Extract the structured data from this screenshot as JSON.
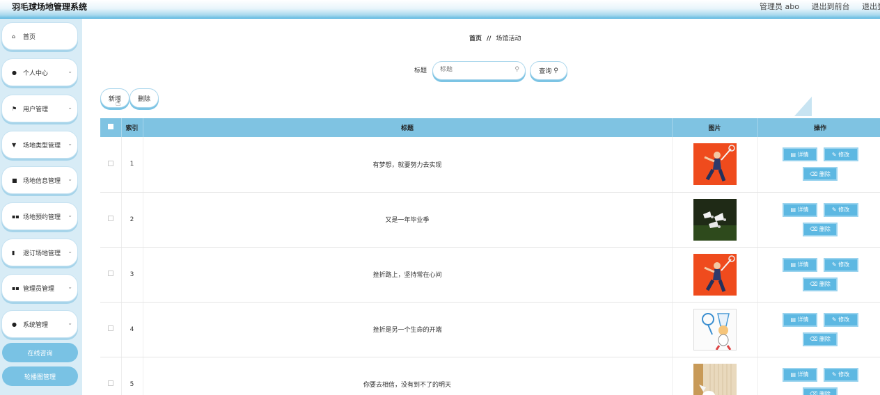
{
  "header": {
    "title": "羽毛球场地管理系统",
    "user": "管理员 abo",
    "to_front": "退出到前台",
    "logout": "退出登录"
  },
  "sidebar": {
    "items": [
      {
        "label": "首页",
        "icon": "home-icon",
        "glyph": "⌂",
        "arrow": ""
      },
      {
        "label": "个人中心",
        "icon": "user-icon",
        "glyph": "●",
        "arrow": "⌄"
      },
      {
        "label": "用户管理",
        "icon": "flag-icon",
        "glyph": "⚑",
        "arrow": "⌄"
      },
      {
        "label": "场地类型管理",
        "icon": "tag-icon",
        "glyph": "▼",
        "arrow": "⌄"
      },
      {
        "label": "场地信息管理",
        "icon": "checkbox-icon",
        "glyph": "■",
        "arrow": "⌄"
      },
      {
        "label": "场地预约管理",
        "icon": "grid-icon",
        "glyph": "▪▪",
        "arrow": "⌄"
      },
      {
        "label": "退订场地管理",
        "icon": "trash-icon",
        "glyph": "▮",
        "arrow": "⌄"
      },
      {
        "label": "管理员管理",
        "icon": "grid-icon",
        "glyph": "▪▪",
        "arrow": "⌄"
      },
      {
        "label": "系统管理",
        "icon": "user-icon",
        "glyph": "●",
        "arrow": "⌄"
      }
    ],
    "sub_items": [
      "在线咨询",
      "轮播图管理"
    ]
  },
  "breadcrumb": {
    "home": "首页",
    "separator": "//",
    "current": "场馆活动"
  },
  "search": {
    "label": "标题",
    "placeholder": "标题",
    "button": "查询"
  },
  "toolbar": {
    "add": "新增",
    "delete": "删除"
  },
  "table": {
    "columns": [
      "索引",
      "标题",
      "图片",
      "操作"
    ],
    "rows": [
      {
        "index": "1",
        "title": "有梦想，就要努力去实现",
        "image": "player"
      },
      {
        "index": "2",
        "title": "又是一年毕业季",
        "image": "shuttlecocks"
      },
      {
        "index": "3",
        "title": "挫折路上，坚持常在心间",
        "image": "player"
      },
      {
        "index": "4",
        "title": "挫折是另一个生命的开端",
        "image": "cartoon"
      },
      {
        "index": "5",
        "title": "你要去相信，没有到不了的明天",
        "image": "net"
      }
    ],
    "actions": {
      "detail": "详情",
      "edit": "修改",
      "delete": "删除"
    }
  }
}
